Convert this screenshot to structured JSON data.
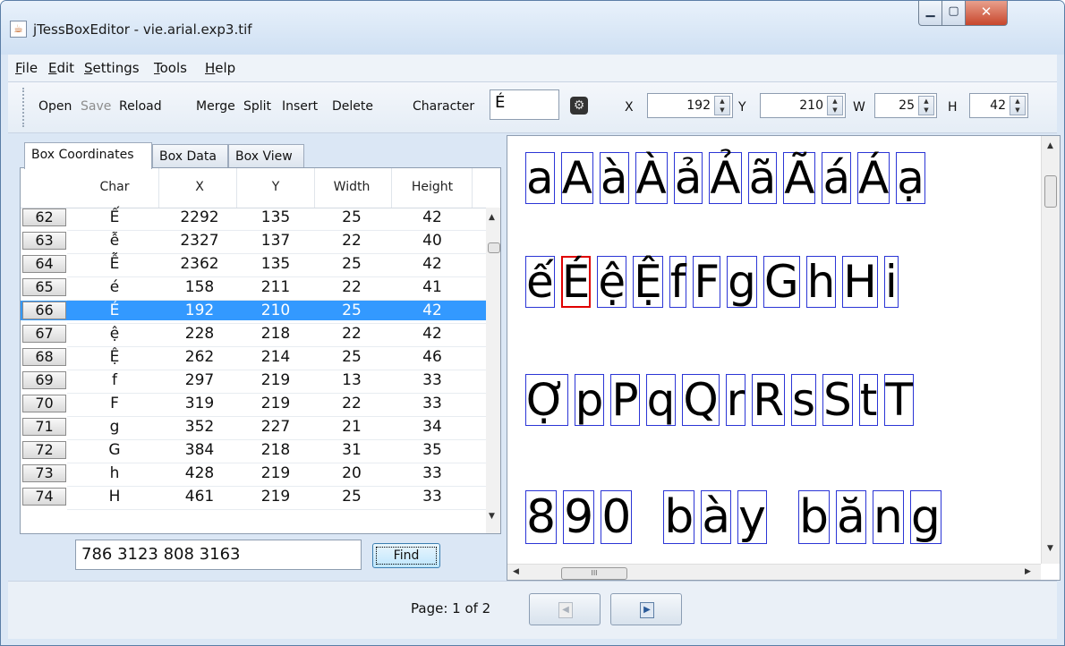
{
  "window": {
    "title": "jTessBoxEditor - vie.arial.exp3.tif",
    "app_icon": "java-cup-icon"
  },
  "menu": [
    "File",
    "Edit",
    "Settings",
    "Tools",
    "Help"
  ],
  "toolbar": {
    "open": "Open",
    "save": "Save",
    "reload": "Reload",
    "merge": "Merge",
    "split": "Split",
    "insert": "Insert",
    "delete": "Delete",
    "character_label": "Character",
    "character_value": "É",
    "x_label": "X",
    "x_value": "192",
    "y_label": "Y",
    "y_value": "210",
    "w_label": "W",
    "w_value": "25",
    "h_label": "H",
    "h_value": "42"
  },
  "tabs": [
    "Box Coordinates",
    "Box Data",
    "Box View"
  ],
  "table": {
    "columns": [
      "Char",
      "X",
      "Y",
      "Width",
      "Height"
    ],
    "rows": [
      {
        "n": "62",
        "char": "Ế",
        "x": "2292",
        "y": "135",
        "w": "25",
        "h": "42"
      },
      {
        "n": "63",
        "char": "ễ",
        "x": "2327",
        "y": "137",
        "w": "22",
        "h": "40"
      },
      {
        "n": "64",
        "char": "Ễ",
        "x": "2362",
        "y": "135",
        "w": "25",
        "h": "42"
      },
      {
        "n": "65",
        "char": "é",
        "x": "158",
        "y": "211",
        "w": "22",
        "h": "41"
      },
      {
        "n": "66",
        "char": "É",
        "x": "192",
        "y": "210",
        "w": "25",
        "h": "42"
      },
      {
        "n": "67",
        "char": "ệ",
        "x": "228",
        "y": "218",
        "w": "22",
        "h": "42"
      },
      {
        "n": "68",
        "char": "Ệ",
        "x": "262",
        "y": "214",
        "w": "25",
        "h": "46"
      },
      {
        "n": "69",
        "char": "f",
        "x": "297",
        "y": "219",
        "w": "13",
        "h": "33"
      },
      {
        "n": "70",
        "char": "F",
        "x": "319",
        "y": "219",
        "w": "22",
        "h": "33"
      },
      {
        "n": "71",
        "char": "g",
        "x": "352",
        "y": "227",
        "w": "21",
        "h": "34"
      },
      {
        "n": "72",
        "char": "G",
        "x": "384",
        "y": "218",
        "w": "31",
        "h": "35"
      },
      {
        "n": "73",
        "char": "h",
        "x": "428",
        "y": "219",
        "w": "20",
        "h": "33"
      },
      {
        "n": "74",
        "char": "H",
        "x": "461",
        "y": "219",
        "w": "25",
        "h": "33"
      }
    ],
    "selected_row": "66"
  },
  "find": {
    "value": "786 3123 808 3163",
    "button": "Find"
  },
  "viewer": {
    "lines": [
      [
        "a",
        "A",
        "à",
        "À",
        "ả",
        "Ả",
        "ã",
        "Ã",
        "á",
        "Á",
        "ạ"
      ],
      [
        "ế",
        "É",
        "ệ",
        "Ệ",
        "f",
        "F",
        "g",
        "G",
        "h",
        "H",
        "i"
      ],
      [
        "Ợ",
        "p",
        "P",
        "q",
        "Q",
        "r",
        "R",
        "s",
        "S",
        "t",
        "T"
      ],
      [
        "8",
        "9",
        "0",
        "b",
        "à",
        "y",
        "b",
        "ă",
        "n",
        "g"
      ]
    ],
    "scroll_thumb_label": "III"
  },
  "status": {
    "page": "Page: 1 of 2"
  }
}
